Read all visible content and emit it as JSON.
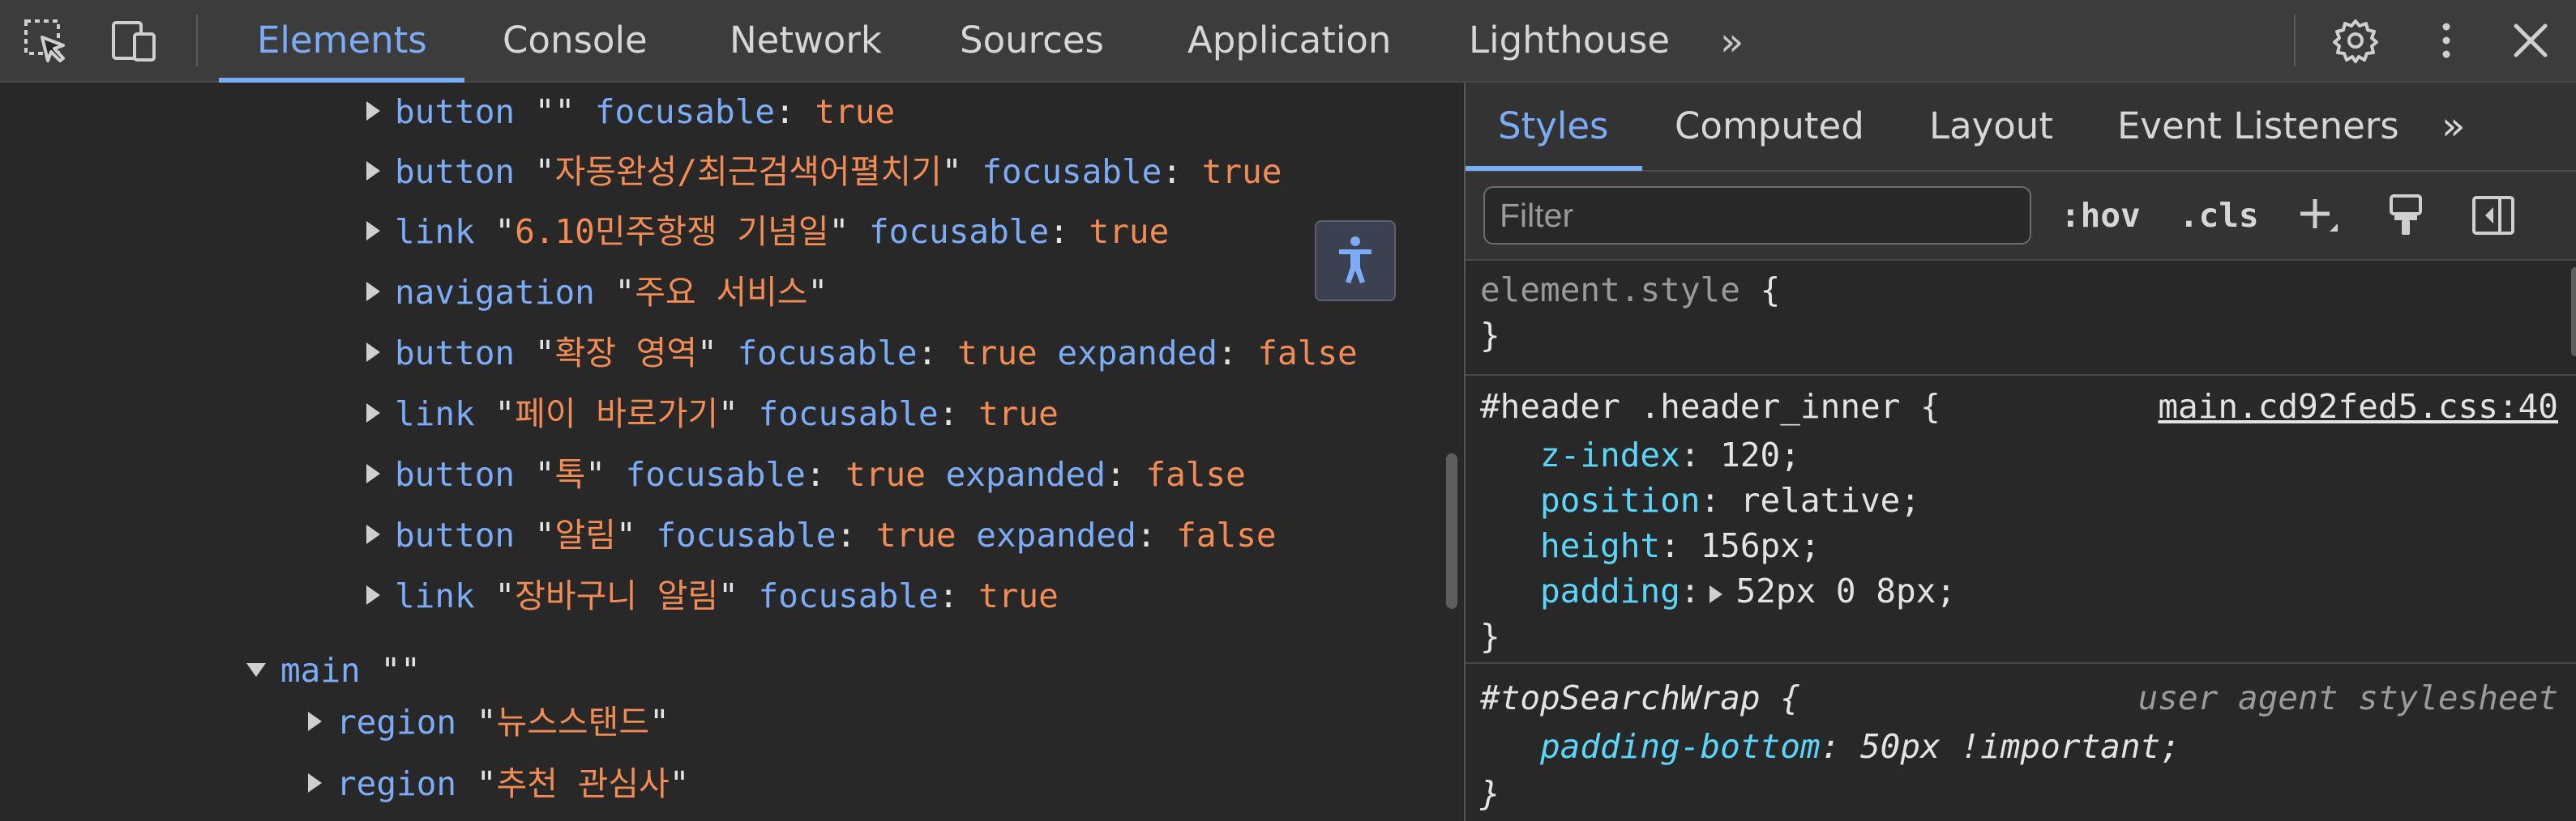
{
  "toolbar": {
    "tabs": [
      "Elements",
      "Console",
      "Network",
      "Sources",
      "Application",
      "Lighthouse"
    ],
    "active_tab": "Elements",
    "more_tabs_glyph": "»",
    "icons": [
      "inspect-element-icon",
      "device-toolbar-icon",
      "settings-gear-icon",
      "more-vertical-icon",
      "close-icon"
    ]
  },
  "tree": {
    "rows": [
      {
        "role": "button",
        "name": "",
        "props": [
          {
            "k": "focusable",
            "v": "true"
          }
        ]
      },
      {
        "role": "button",
        "name": "자동완성/최근검색어펼치기",
        "props": [
          {
            "k": "focusable",
            "v": "true"
          }
        ]
      },
      {
        "role": "link",
        "name": "6.10민주항쟁 기념일",
        "props": [
          {
            "k": "focusable",
            "v": "true"
          }
        ]
      },
      {
        "role": "navigation",
        "name": "주요 서비스",
        "props": []
      },
      {
        "role": "button",
        "name": "확장 영역",
        "props": [
          {
            "k": "focusable",
            "v": "true"
          },
          {
            "k": "expanded",
            "v": "false"
          }
        ]
      },
      {
        "role": "link",
        "name": "페이 바로가기",
        "props": [
          {
            "k": "focusable",
            "v": "true"
          }
        ]
      },
      {
        "role": "button",
        "name": "톡",
        "props": [
          {
            "k": "focusable",
            "v": "true"
          },
          {
            "k": "expanded",
            "v": "false"
          }
        ]
      },
      {
        "role": "button",
        "name": "알림",
        "props": [
          {
            "k": "focusable",
            "v": "true"
          },
          {
            "k": "expanded",
            "v": "false"
          }
        ]
      },
      {
        "role": "link",
        "name": "장바구니 알림",
        "props": [
          {
            "k": "focusable",
            "v": "true"
          }
        ]
      },
      {
        "role": "main",
        "name": "",
        "props": []
      },
      {
        "role": "region",
        "name": "뉴스스탠드",
        "props": []
      },
      {
        "role": "region",
        "name": "추천 관심사",
        "props": []
      }
    ]
  },
  "styles_panel": {
    "tabs": [
      "Styles",
      "Computed",
      "Layout",
      "Event Listeners"
    ],
    "active_tab": "Styles",
    "more_tabs_glyph": "»",
    "filter_placeholder": "Filter",
    "hov_label": ":hov",
    "cls_label": ".cls",
    "element_style": {
      "selector": "element.style",
      "open": "{",
      "close": "}"
    },
    "rule1": {
      "selector": "#header .header_inner",
      "open": "{",
      "source": "main.cd92fed5.css:40",
      "decls": [
        {
          "prop": "z-index",
          "value": "120;"
        },
        {
          "prop": "position",
          "value": "relative;"
        },
        {
          "prop": "height",
          "value": "156px;"
        },
        {
          "prop": "padding",
          "value": "52px 0 8px;"
        }
      ],
      "close": "}"
    },
    "rule2": {
      "selector": "#topSearchWrap",
      "open": "{",
      "source": "user agent stylesheet",
      "decls": [
        {
          "prop": "padding-bottom",
          "value": "50px !important;"
        }
      ],
      "close": "}"
    }
  },
  "colors": {
    "accent": "#7cacf8",
    "string": "#f28b54",
    "css_property": "#5cd5fb",
    "background": "#282828",
    "toolbar_bg": "#3c3c3c"
  }
}
